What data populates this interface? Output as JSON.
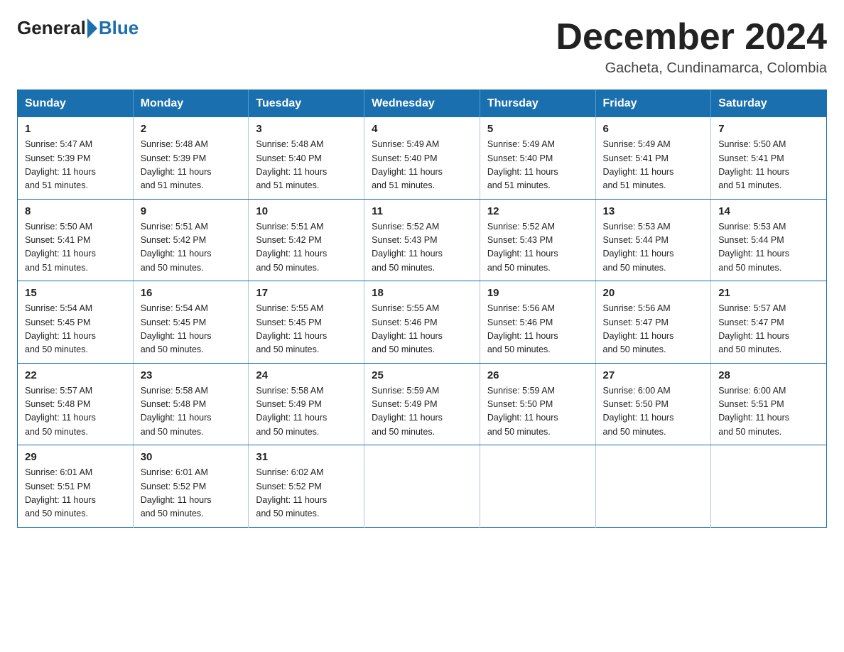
{
  "logo": {
    "general": "General",
    "blue": "Blue"
  },
  "title": "December 2024",
  "location": "Gacheta, Cundinamarca, Colombia",
  "days_of_week": [
    "Sunday",
    "Monday",
    "Tuesday",
    "Wednesday",
    "Thursday",
    "Friday",
    "Saturday"
  ],
  "weeks": [
    [
      {
        "day": "1",
        "sunrise": "5:47 AM",
        "sunset": "5:39 PM",
        "daylight": "11 hours and 51 minutes."
      },
      {
        "day": "2",
        "sunrise": "5:48 AM",
        "sunset": "5:39 PM",
        "daylight": "11 hours and 51 minutes."
      },
      {
        "day": "3",
        "sunrise": "5:48 AM",
        "sunset": "5:40 PM",
        "daylight": "11 hours and 51 minutes."
      },
      {
        "day": "4",
        "sunrise": "5:49 AM",
        "sunset": "5:40 PM",
        "daylight": "11 hours and 51 minutes."
      },
      {
        "day": "5",
        "sunrise": "5:49 AM",
        "sunset": "5:40 PM",
        "daylight": "11 hours and 51 minutes."
      },
      {
        "day": "6",
        "sunrise": "5:49 AM",
        "sunset": "5:41 PM",
        "daylight": "11 hours and 51 minutes."
      },
      {
        "day": "7",
        "sunrise": "5:50 AM",
        "sunset": "5:41 PM",
        "daylight": "11 hours and 51 minutes."
      }
    ],
    [
      {
        "day": "8",
        "sunrise": "5:50 AM",
        "sunset": "5:41 PM",
        "daylight": "11 hours and 51 minutes."
      },
      {
        "day": "9",
        "sunrise": "5:51 AM",
        "sunset": "5:42 PM",
        "daylight": "11 hours and 50 minutes."
      },
      {
        "day": "10",
        "sunrise": "5:51 AM",
        "sunset": "5:42 PM",
        "daylight": "11 hours and 50 minutes."
      },
      {
        "day": "11",
        "sunrise": "5:52 AM",
        "sunset": "5:43 PM",
        "daylight": "11 hours and 50 minutes."
      },
      {
        "day": "12",
        "sunrise": "5:52 AM",
        "sunset": "5:43 PM",
        "daylight": "11 hours and 50 minutes."
      },
      {
        "day": "13",
        "sunrise": "5:53 AM",
        "sunset": "5:44 PM",
        "daylight": "11 hours and 50 minutes."
      },
      {
        "day": "14",
        "sunrise": "5:53 AM",
        "sunset": "5:44 PM",
        "daylight": "11 hours and 50 minutes."
      }
    ],
    [
      {
        "day": "15",
        "sunrise": "5:54 AM",
        "sunset": "5:45 PM",
        "daylight": "11 hours and 50 minutes."
      },
      {
        "day": "16",
        "sunrise": "5:54 AM",
        "sunset": "5:45 PM",
        "daylight": "11 hours and 50 minutes."
      },
      {
        "day": "17",
        "sunrise": "5:55 AM",
        "sunset": "5:45 PM",
        "daylight": "11 hours and 50 minutes."
      },
      {
        "day": "18",
        "sunrise": "5:55 AM",
        "sunset": "5:46 PM",
        "daylight": "11 hours and 50 minutes."
      },
      {
        "day": "19",
        "sunrise": "5:56 AM",
        "sunset": "5:46 PM",
        "daylight": "11 hours and 50 minutes."
      },
      {
        "day": "20",
        "sunrise": "5:56 AM",
        "sunset": "5:47 PM",
        "daylight": "11 hours and 50 minutes."
      },
      {
        "day": "21",
        "sunrise": "5:57 AM",
        "sunset": "5:47 PM",
        "daylight": "11 hours and 50 minutes."
      }
    ],
    [
      {
        "day": "22",
        "sunrise": "5:57 AM",
        "sunset": "5:48 PM",
        "daylight": "11 hours and 50 minutes."
      },
      {
        "day": "23",
        "sunrise": "5:58 AM",
        "sunset": "5:48 PM",
        "daylight": "11 hours and 50 minutes."
      },
      {
        "day": "24",
        "sunrise": "5:58 AM",
        "sunset": "5:49 PM",
        "daylight": "11 hours and 50 minutes."
      },
      {
        "day": "25",
        "sunrise": "5:59 AM",
        "sunset": "5:49 PM",
        "daylight": "11 hours and 50 minutes."
      },
      {
        "day": "26",
        "sunrise": "5:59 AM",
        "sunset": "5:50 PM",
        "daylight": "11 hours and 50 minutes."
      },
      {
        "day": "27",
        "sunrise": "6:00 AM",
        "sunset": "5:50 PM",
        "daylight": "11 hours and 50 minutes."
      },
      {
        "day": "28",
        "sunrise": "6:00 AM",
        "sunset": "5:51 PM",
        "daylight": "11 hours and 50 minutes."
      }
    ],
    [
      {
        "day": "29",
        "sunrise": "6:01 AM",
        "sunset": "5:51 PM",
        "daylight": "11 hours and 50 minutes."
      },
      {
        "day": "30",
        "sunrise": "6:01 AM",
        "sunset": "5:52 PM",
        "daylight": "11 hours and 50 minutes."
      },
      {
        "day": "31",
        "sunrise": "6:02 AM",
        "sunset": "5:52 PM",
        "daylight": "11 hours and 50 minutes."
      },
      null,
      null,
      null,
      null
    ]
  ],
  "labels": {
    "sunrise": "Sunrise:",
    "sunset": "Sunset:",
    "daylight": "Daylight:"
  }
}
